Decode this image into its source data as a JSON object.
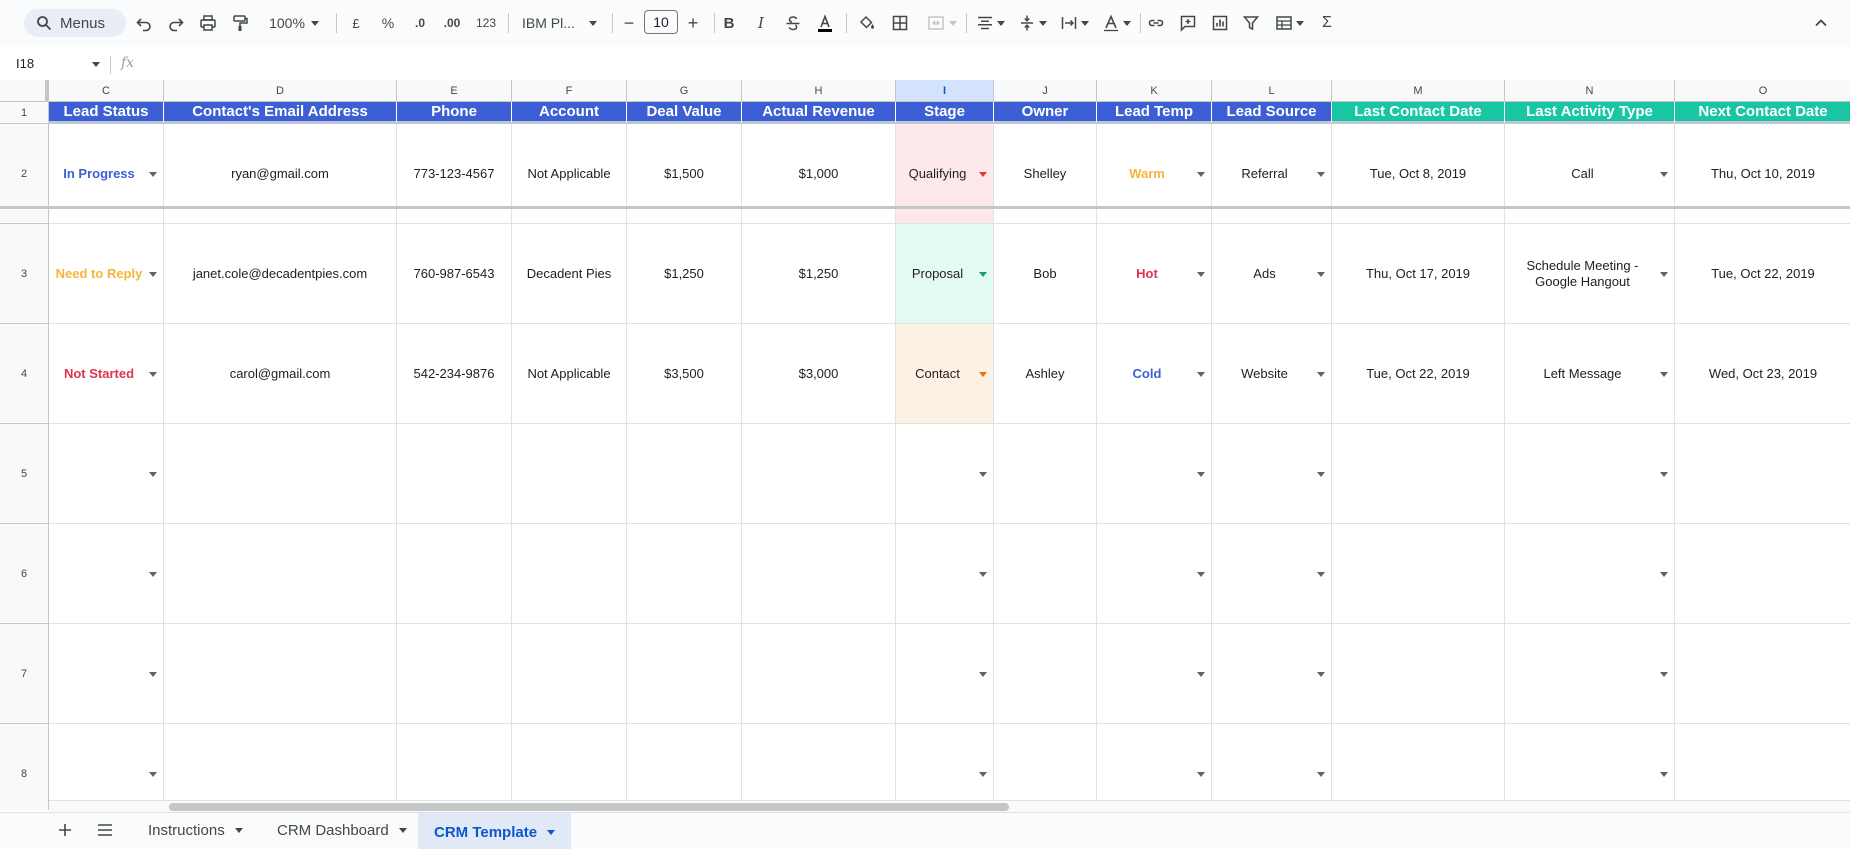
{
  "toolbar": {
    "menus_label": "Menus",
    "zoom": "100%",
    "currency_symbol": "£",
    "percent_symbol": "%",
    "decrease_decimal": ".0",
    "increase_decimal": ".00",
    "number_format": "123",
    "font_name": "IBM Pl...",
    "font_size": "10",
    "decrease_font": "−",
    "increase_font": "+",
    "bold": "B",
    "italic": "I",
    "sum_symbol": "Σ"
  },
  "formula_bar": {
    "name_box": "I18",
    "fx": "fx"
  },
  "columns": [
    {
      "letter": "C",
      "header": "Lead Status",
      "header_color": "#3d5fd6"
    },
    {
      "letter": "D",
      "header": "Contact's Email Address",
      "header_color": "#3d5fd6"
    },
    {
      "letter": "E",
      "header": "Phone",
      "header_color": "#3d5fd6"
    },
    {
      "letter": "F",
      "header": "Account",
      "header_color": "#3d5fd6"
    },
    {
      "letter": "G",
      "header": "Deal Value",
      "header_color": "#3d5fd6"
    },
    {
      "letter": "H",
      "header": "Actual Revenue",
      "header_color": "#3d5fd6"
    },
    {
      "letter": "I",
      "header": "Stage",
      "header_color": "#3d5fd6"
    },
    {
      "letter": "J",
      "header": "Owner",
      "header_color": "#3d5fd6"
    },
    {
      "letter": "K",
      "header": "Lead Temp",
      "header_color": "#3d5fd6"
    },
    {
      "letter": "L",
      "header": "Lead Source",
      "header_color": "#3d5fd6"
    },
    {
      "letter": "M",
      "header": "Last Contact Date",
      "header_color": "#19c6a4"
    },
    {
      "letter": "N",
      "header": "Last Activity Type",
      "header_color": "#19c6a4"
    },
    {
      "letter": "O",
      "header": "Next Contact Date",
      "header_color": "#19c6a4"
    }
  ],
  "selected_column": "I",
  "row_numbers": [
    "1",
    "2",
    "3",
    "4",
    "5",
    "6",
    "7",
    "8"
  ],
  "rows": [
    {
      "lead_status": "In Progress",
      "lead_status_color": "#3d5fd6",
      "email": "ryan@gmail.com",
      "phone": "773-123-4567",
      "account": "Not Applicable",
      "deal_value": "$1,500",
      "actual_revenue": "$1,000",
      "stage": "Qualifying",
      "stage_bg": "#fde8ec",
      "owner": "Shelley",
      "lead_temp": "Warm",
      "lead_temp_color": "#f3b53b",
      "lead_source": "Referral",
      "last_contact_date": "Tue, Oct 8, 2019",
      "last_activity_type": "Call",
      "next_contact_date": "Thu, Oct 10, 2019"
    },
    {
      "lead_status": "Need to Reply",
      "lead_status_color": "#f3b53b",
      "email": "janet.cole@decadentpies.com",
      "phone": "760-987-6543",
      "account": "Decadent Pies",
      "deal_value": "$1,250",
      "actual_revenue": "$1,250",
      "stage": "Proposal",
      "stage_bg": "#e3faf4",
      "owner": "Bob",
      "lead_temp": "Hot",
      "lead_temp_color": "#e0344f",
      "lead_source": "Ads",
      "last_contact_date": "Thu, Oct 17, 2019",
      "last_activity_type": "Schedule Meeting - Google Hangout",
      "next_contact_date": "Tue, Oct 22, 2019"
    },
    {
      "lead_status": "Not Started",
      "lead_status_color": "#e0344f",
      "email": "carol@gmail.com",
      "phone": "542-234-9876",
      "account": "Not Applicable",
      "deal_value": "$3,500",
      "actual_revenue": "$3,000",
      "stage": "Contact",
      "stage_bg": "#fdf1e6",
      "owner": "Ashley",
      "lead_temp": "Cold",
      "lead_temp_color": "#3d5fd6",
      "lead_source": "Website",
      "last_contact_date": "Tue, Oct 22, 2019",
      "last_activity_type": "Left Message",
      "next_contact_date": "Wed, Oct 23, 2019"
    }
  ],
  "sheet_tabs": [
    {
      "label": "Instructions",
      "active": false
    },
    {
      "label": "CRM Dashboard",
      "active": false
    },
    {
      "label": "CRM Template",
      "active": true
    }
  ],
  "icons": {
    "add_sheet": "plus-icon",
    "all_sheets": "menu-icon",
    "search": "search-icon",
    "collapse": "chevron-up-icon"
  }
}
